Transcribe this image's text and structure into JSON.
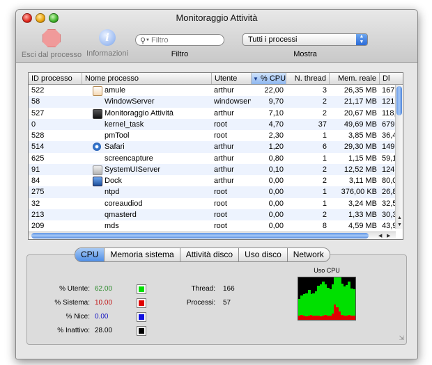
{
  "window": {
    "title": "Monitoraggio Attività"
  },
  "toolbar": {
    "quit_label": "Esci dal processo",
    "info_label": "Informazioni",
    "filter_placeholder": "Filtro",
    "filter_label": "Filtro",
    "show_value": "Tutti i processi",
    "show_label": "Mostra"
  },
  "table": {
    "columns": [
      "ID processo",
      "Nome processo",
      "Utente",
      "% CPU",
      "N. thread",
      "Mem. reale",
      "Dl"
    ],
    "sorted_column": "% CPU",
    "rows": [
      {
        "pid": "522",
        "name": "amule",
        "user": "arthur",
        "cpu": "22,00",
        "threads": "3",
        "mem": "26,35 MB",
        "vm": "167,",
        "icon": "amule-icon"
      },
      {
        "pid": "58",
        "name": "WindowServer",
        "user": "windowserv",
        "cpu": "9,70",
        "threads": "2",
        "mem": "21,17 MB",
        "vm": "121,",
        "icon": ""
      },
      {
        "pid": "527",
        "name": "Monitoraggio Attività",
        "user": "arthur",
        "cpu": "7,10",
        "threads": "2",
        "mem": "20,67 MB",
        "vm": "118,",
        "icon": "activity-monitor-icon"
      },
      {
        "pid": "0",
        "name": "kernel_task",
        "user": "root",
        "cpu": "4,70",
        "threads": "37",
        "mem": "49,69 MB",
        "vm": "679,",
        "icon": ""
      },
      {
        "pid": "528",
        "name": "pmTool",
        "user": "root",
        "cpu": "2,30",
        "threads": "1",
        "mem": "3,85 MB",
        "vm": "36,4",
        "icon": ""
      },
      {
        "pid": "514",
        "name": "Safari",
        "user": "arthur",
        "cpu": "1,20",
        "threads": "6",
        "mem": "29,30 MB",
        "vm": "149,",
        "icon": "safari-icon"
      },
      {
        "pid": "625",
        "name": "screencapture",
        "user": "arthur",
        "cpu": "0,80",
        "threads": "1",
        "mem": "1,15 MB",
        "vm": "59,1",
        "icon": ""
      },
      {
        "pid": "91",
        "name": "SystemUIServer",
        "user": "arthur",
        "cpu": "0,10",
        "threads": "2",
        "mem": "12,52 MB",
        "vm": "124,",
        "icon": "systemuiserver-icon"
      },
      {
        "pid": "84",
        "name": "Dock",
        "user": "arthur",
        "cpu": "0,00",
        "threads": "2",
        "mem": "3,11 MB",
        "vm": "80,0",
        "icon": "dock-icon"
      },
      {
        "pid": "275",
        "name": "ntpd",
        "user": "root",
        "cpu": "0,00",
        "threads": "1",
        "mem": "376,00 KB",
        "vm": "26,8",
        "icon": ""
      },
      {
        "pid": "32",
        "name": "coreaudiod",
        "user": "root",
        "cpu": "0,00",
        "threads": "1",
        "mem": "3,24 MB",
        "vm": "32,5",
        "icon": ""
      },
      {
        "pid": "213",
        "name": "qmasterd",
        "user": "root",
        "cpu": "0,00",
        "threads": "2",
        "mem": "1,33 MB",
        "vm": "30,3",
        "icon": ""
      },
      {
        "pid": "209",
        "name": "mds",
        "user": "root",
        "cpu": "0,00",
        "threads": "8",
        "mem": "4,59 MB",
        "vm": "43,9",
        "icon": ""
      }
    ]
  },
  "tabs": [
    "CPU",
    "Memoria sistema",
    "Attività disco",
    "Uso disco",
    "Network"
  ],
  "active_tab": "CPU",
  "cpu": {
    "user_label": "% Utente:",
    "user_value": "62.00",
    "user_color": "#00e000",
    "system_label": "% Sistema:",
    "system_value": "10.00",
    "system_color": "#e00000",
    "nice_label": "% Nice:",
    "nice_value": "0.00",
    "nice_color": "#1010e0",
    "idle_label": "% Inattivo:",
    "idle_value": "28.00",
    "idle_color": "#000000",
    "threads_label": "Thread:",
    "threads_value": "166",
    "processes_label": "Processi:",
    "processes_value": "57",
    "graph_title": "Uso CPU"
  },
  "cpu_history": {
    "user_percent": [
      40,
      45,
      50,
      55,
      60,
      48,
      52,
      58,
      70,
      75,
      80,
      72,
      66,
      62,
      70,
      85,
      90,
      80,
      74,
      68,
      72,
      78,
      64,
      62
    ],
    "system_percent": [
      10,
      12,
      10,
      8,
      10,
      12,
      10,
      10,
      10,
      8,
      10,
      12,
      10,
      10,
      14,
      36,
      30,
      20,
      12,
      10,
      10,
      12,
      10,
      10
    ]
  }
}
